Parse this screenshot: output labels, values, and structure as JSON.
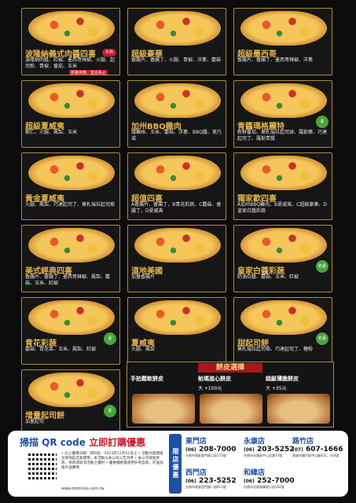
{
  "pizzas": [
    {
      "name": "波隆納義式肉醬四喜",
      "desc": "波隆納肉醬、紅椒、墨西哥辣椒、火腿、起司粉、青椒、番茄、玉米",
      "badge": "牛肉",
      "badge_type": "red",
      "tag": "限量供應、售完為止"
    },
    {
      "name": "超級豪華",
      "desc": "香腸片、香腸丁、火腿、青椒、洋蔥、蘑菇"
    },
    {
      "name": "超級墨西哥",
      "desc": "香腸片、香腸丁、墨西哥辣椒、洋蔥"
    },
    {
      "name": "超級夏威夷",
      "desc": "蝦仁、火腿、鳳梨、玉米"
    },
    {
      "name": "加州BBQ雞肉",
      "desc": "燻雞絲、玉米、蘑菇、洋蔥、BBQ醬、美乃滋"
    },
    {
      "name": "青醬瑪格麗特",
      "desc": "新鮮番茄、莫札瑞拉起司球、羅勒葉、巧達起司丁、羅勒青醬",
      "badge": "素",
      "badge_type": "green"
    },
    {
      "name": "黃金夏威夷",
      "desc": "火腿、鳳梨、巧達起司丁、莫札瑞拉起司條"
    },
    {
      "name": "超值四喜",
      "desc": "A香腸片、香腸丁，B青花彩蔬、C蘑菇、香腸丁，D夏威夷"
    },
    {
      "name": "獨家歡四喜",
      "desc": "A加州BBQ雞肉、B夏威夷、C超級豪華、D皇家白醬彩蔬"
    },
    {
      "name": "美式經典四喜",
      "desc": "香腸片、香腸丁、墨西哥辣椒、鳳梨、蘑菇、玉米、紅椒"
    },
    {
      "name": "道地美國",
      "desc": "加量香腸片"
    },
    {
      "name": "皇家白醬彩蔬",
      "desc": "奶油白醬、蘑菇、玉米、紅椒",
      "badge": "奶素",
      "badge_type": "green"
    },
    {
      "name": "青花彩蔬",
      "desc": "蘑菇、青花菜、玉米、鳳梨、紅椒",
      "badge": "素",
      "badge_type": "green"
    },
    {
      "name": "夏威夷",
      "desc": "火腿、鳳梨"
    },
    {
      "name": "甜起司餅",
      "desc": "莫札瑞拉起司條、巧達起司丁、糖粉",
      "badge": "奶素",
      "badge_type": "green"
    },
    {
      "name": "增量起司餅",
      "desc": "加量起司",
      "badge": "素",
      "badge_type": "green"
    }
  ],
  "crust": {
    "title": "餅皮選擇",
    "items": [
      {
        "label": "手拍鬆軟餅皮",
        "price": ""
      },
      {
        "label": "帕瑪滋心餅皮",
        "price": "大 +100元"
      },
      {
        "label": "超級薄脆餅皮",
        "price": "大 +35元"
      }
    ]
  },
  "promo": {
    "headline_a": "掃描 QR code ",
    "headline_b": "立即訂購優惠",
    "notes": "• 以上優惠日期：即日起 - 2023年12月31日止 • 活動內容僅限台南地區店家使用，本活動以本公司公告為準 • 本公司保留更改、修改或取消活動之權利 • 優惠價格僅適用外帶自取，外送加收外送費用",
    "url": "www.dominos.com.tw",
    "vertical": "限店優惠",
    "stores": [
      {
        "name": "東門店",
        "area": "(06)",
        "phone": "208-7000",
        "addr": "台南市東區東門路二段173號"
      },
      {
        "name": "永康店",
        "area": "(06)",
        "phone": "203-5252",
        "addr": "台南市永康區中山北路74號"
      },
      {
        "name": "路竹店",
        "area": "(07)",
        "phone": "607-1666",
        "addr": "高雄市路竹區中山路432、434號"
      },
      {
        "name": "西門店",
        "area": "(06)",
        "phone": "223-5252",
        "addr": "台南市南區西門路一段611號"
      },
      {
        "name": "和緯店",
        "area": "(06)",
        "phone": "252-7000",
        "addr": "台南市北區和緯路二段162號"
      }
    ]
  }
}
